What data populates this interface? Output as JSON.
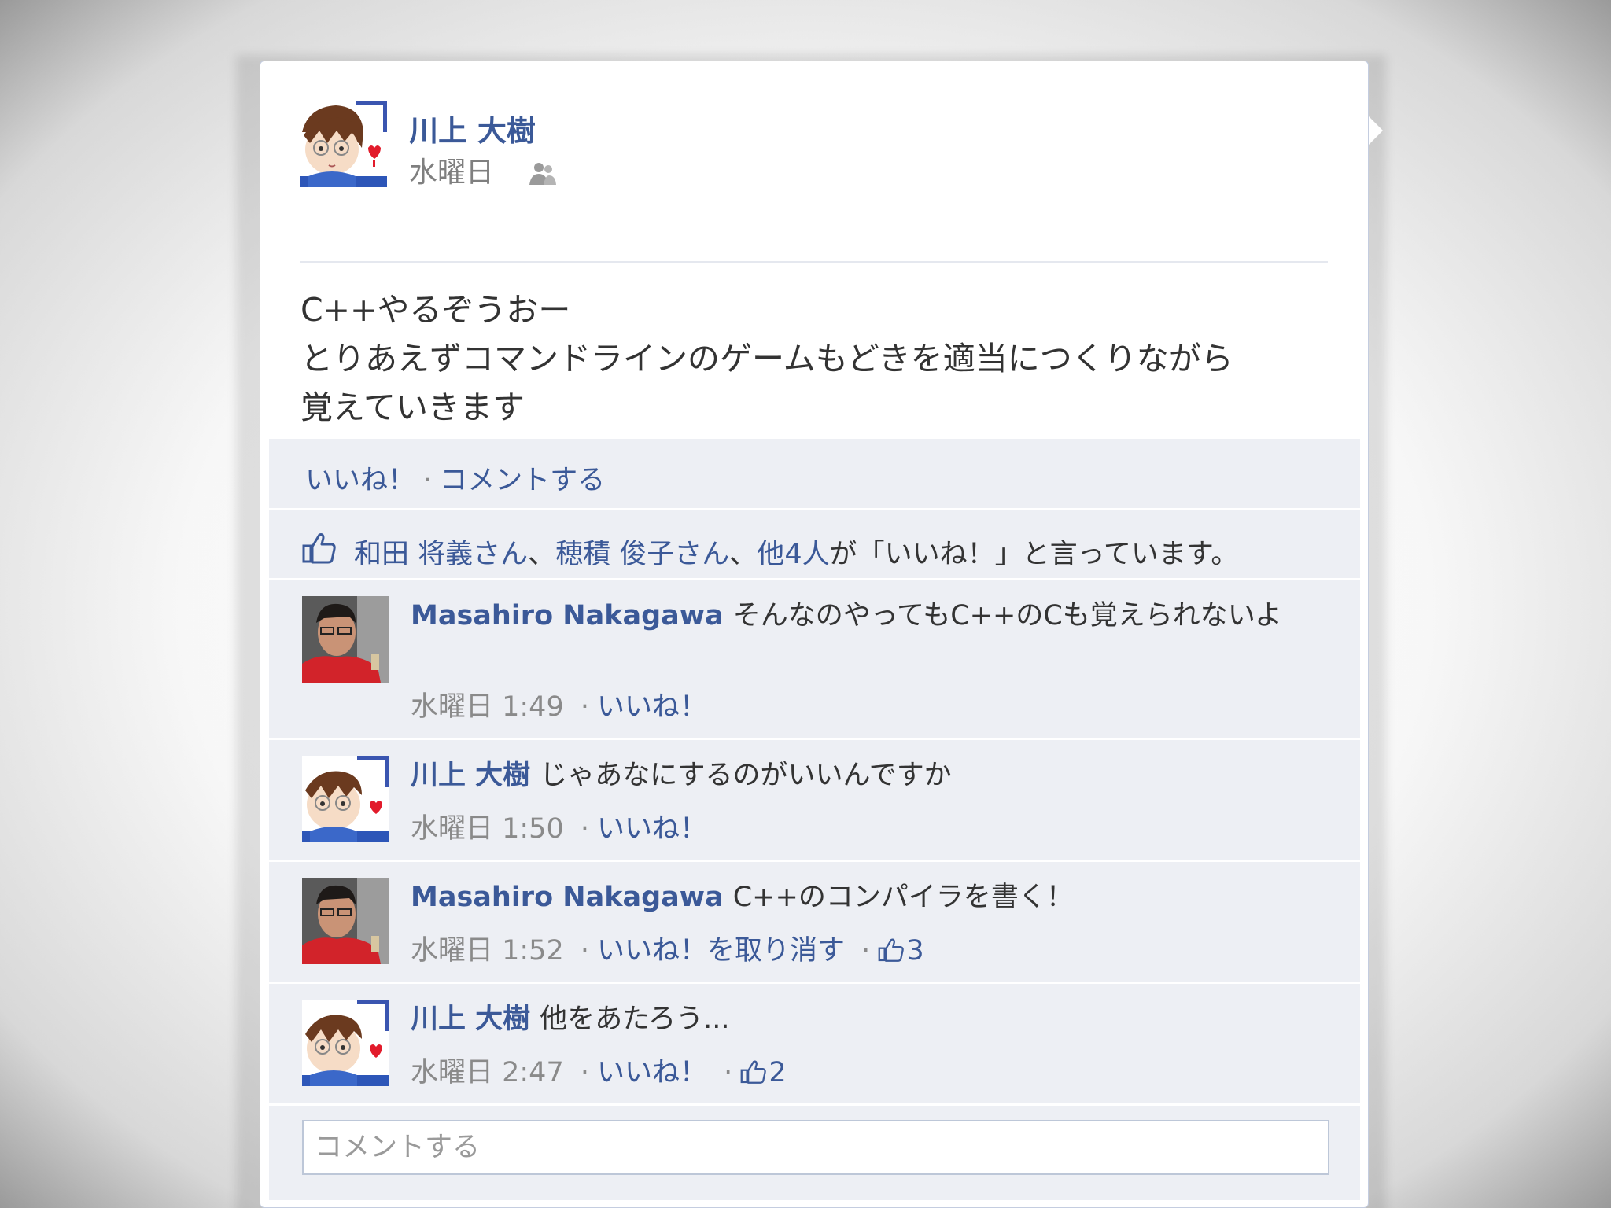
{
  "post": {
    "author": "川上 大樹",
    "time": "水曜日",
    "audience_icon": "friends-icon",
    "body_lines": [
      "C++やるぞうおー",
      "とりあえずコマンドラインのゲームもどきを適当につくりながら",
      "覚えていきます"
    ]
  },
  "actions": {
    "like": "いいね！",
    "separator": "·",
    "comment": "コメントする"
  },
  "likes": {
    "icon": "thumbs-up-icon",
    "person1": "和田 将義さん",
    "sep1": "、",
    "person2": "穂積 俊子さん",
    "sep2": "、",
    "others": "他4人",
    "suffix": "が「いいね！」と言っています。"
  },
  "comments": [
    {
      "author": "Masahiro Nakagawa",
      "text": "そんなのやってもC++のCも覚えられないよ",
      "time": "水曜日 1:49",
      "sep": "·",
      "like_label": "いいね！",
      "like_count": ""
    },
    {
      "author": "川上 大樹",
      "text": "じゃあなにするのがいいんですか",
      "time": "水曜日 1:50",
      "sep": "·",
      "like_label": "いいね！",
      "like_count": ""
    },
    {
      "author": "Masahiro Nakagawa",
      "text": "C++のコンパイラを書く！",
      "time": "水曜日 1:52",
      "sep": "·",
      "like_label": "いいね！を取り消す",
      "like_count": "3"
    },
    {
      "author": "川上 大樹",
      "text": "他をあたろう...",
      "time": "水曜日 2:47",
      "sep": "·",
      "like_label": "いいね！",
      "like_count": "2"
    }
  ],
  "comment_box": {
    "placeholder": "コメントする"
  },
  "colors": {
    "link": "#3b5998",
    "feedback_bg": "#edeff4",
    "meta": "#8a8a8a"
  }
}
